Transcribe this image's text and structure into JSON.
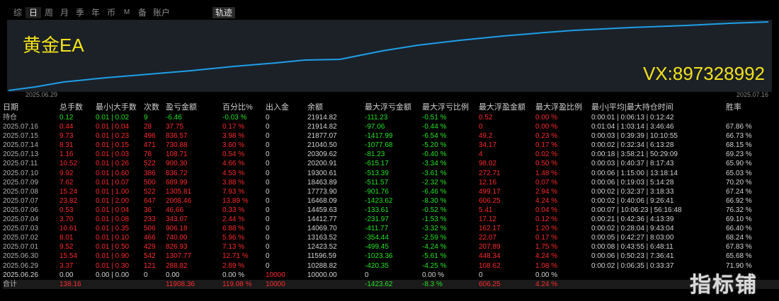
{
  "tabs": [
    {
      "label": "综",
      "active": false
    },
    {
      "label": "日",
      "active": true
    },
    {
      "label": "周",
      "active": false
    },
    {
      "label": "月",
      "active": false
    },
    {
      "label": "季",
      "active": false
    },
    {
      "label": "年",
      "active": false
    },
    {
      "label": "币",
      "active": false
    },
    {
      "label": "M",
      "active": false,
      "small": true
    },
    {
      "label": "备",
      "active": false
    },
    {
      "label": "账户",
      "active": false,
      "wide": true
    }
  ],
  "trail_tab": "轨迹",
  "chart": {
    "title": "黄金EA",
    "contact": "VX:897328992",
    "start_date": "2025.06.29",
    "end_date": "2025.07.16"
  },
  "headers": [
    "日期",
    "总手数",
    "最小|大手数",
    "次数",
    "盈亏金额",
    "百分比%",
    "出入金",
    "余额",
    "最大浮亏金额",
    "最大浮亏比例",
    "最大浮盈金额",
    "最大浮盈比例",
    "最小|平均|最大持仓时间",
    "胜率"
  ],
  "rows": [
    {
      "date": "持仓",
      "lots": "0.12",
      "minmax": "0.01 | 0.02",
      "count": "9",
      "pl": "-6.46",
      "pct": "-0.03 %",
      "io": "0",
      "bal": "21914.82",
      "mfl": "-111.23",
      "mflp": "-0.51 %",
      "mfp": "0.52",
      "mfpp": "0.00 %",
      "time": "0:00:01 | 0:06:13 | 0:12:42",
      "win": "",
      "tone": "green"
    },
    {
      "date": "2025.07.16",
      "lots": "0.44",
      "minmax": "0.01 | 0.04",
      "count": "28",
      "pl": "37.75",
      "pct": "0.17 %",
      "io": "0",
      "bal": "21914.82",
      "mfl": "-97.06",
      "mflp": "-0.44 %",
      "mfp": "0",
      "mfpp": "0.00 %",
      "time": "0:01:04 | 1:03:14 | 3:46:46",
      "win": "67.86 %",
      "tone": "red"
    },
    {
      "date": "2025.07.15",
      "lots": "9.73",
      "minmax": "0.01 | 0.23",
      "count": "496",
      "pl": "836.57",
      "pct": "3.98 %",
      "io": "0",
      "bal": "21877.07",
      "mfl": "-1417.99",
      "mflp": "-6.54 %",
      "mfp": "49.2",
      "mfpp": "0.23 %",
      "time": "0:00:03 | 0:39:39 | 10:10:55",
      "win": "66.73 %",
      "tone": "red"
    },
    {
      "date": "2025.07.14",
      "lots": "8.31",
      "minmax": "0.01 | 0.15",
      "count": "471",
      "pl": "730.88",
      "pct": "3.60 %",
      "io": "0",
      "bal": "21040.50",
      "mfl": "-1077.68",
      "mflp": "-5.20 %",
      "mfp": "34.17",
      "mfpp": "0.17 %",
      "time": "0:00:02 | 0:32:34 | 6:13:28",
      "win": "68.15 %",
      "tone": "red"
    },
    {
      "date": "2025.07.13",
      "lots": "1.16",
      "minmax": "0.01 | 0.03",
      "count": "78",
      "pl": "108.71",
      "pct": "0.54 %",
      "io": "0",
      "bal": "20309.62",
      "mfl": "-81.23",
      "mflp": "-0.40 %",
      "mfp": "4",
      "mfpp": "0.02 %",
      "time": "0:00:18 | 3:58:21 | 50:29:09",
      "win": "69.23 %",
      "tone": "red"
    },
    {
      "date": "2025.07.11",
      "lots": "10.52",
      "minmax": "0.01 | 0.26",
      "count": "522",
      "pl": "900.30",
      "pct": "4.66 %",
      "io": "0",
      "bal": "20200.91",
      "mfl": "-615.17",
      "mflp": "-3.34 %",
      "mfp": "98.02",
      "mfpp": "0.50 %",
      "time": "0:00:03 | 0:40:37 | 8:17:43",
      "win": "65.90 %",
      "tone": "red"
    },
    {
      "date": "2025.07.10",
      "lots": "9.92",
      "minmax": "0.01 | 0.60",
      "count": "386",
      "pl": "836.72",
      "pct": "4.53 %",
      "io": "0",
      "bal": "19300.61",
      "mfl": "-513.39",
      "mflp": "-3.61 %",
      "mfp": "272.71",
      "mfpp": "1.48 %",
      "time": "0:00:06 | 1:15:00 | 13:18:14",
      "win": "65.03 %",
      "tone": "red"
    },
    {
      "date": "2025.07.09",
      "lots": "7.62",
      "minmax": "0.01 | 0.07",
      "count": "500",
      "pl": "689.99",
      "pct": "3.88 %",
      "io": "0",
      "bal": "18463.89",
      "mfl": "-511.57",
      "mflp": "-2.32 %",
      "mfp": "12.16",
      "mfpp": "0.07 %",
      "time": "0:00:06 | 0:19:03 | 5:14:28",
      "win": "70.20 %",
      "tone": "red"
    },
    {
      "date": "2025.07.08",
      "lots": "15.24",
      "minmax": "0.01 | 1.00",
      "count": "522",
      "pl": "1305.81",
      "pct": "7.93 %",
      "io": "0",
      "bal": "17773.90",
      "mfl": "-901.76",
      "mflp": "-6.46 %",
      "mfp": "499.17",
      "mfpp": "2.94 %",
      "time": "0:00:02 | 0:32:37 | 3:18:33",
      "win": "67.24 %",
      "tone": "red"
    },
    {
      "date": "2025.07.07",
      "lots": "23.82",
      "minmax": "0.01 | 2.00",
      "count": "647",
      "pl": "2008.46",
      "pct": "13.89 %",
      "io": "0",
      "bal": "16468.09",
      "mfl": "-1423.62",
      "mflp": "-8.30 %",
      "mfp": "606.25",
      "mfpp": "4.24 %",
      "time": "0:00:02 | 0:40:06 | 9:26:41",
      "win": "66.92 %",
      "tone": "red"
    },
    {
      "date": "2025.07.06",
      "lots": "0.53",
      "minmax": "0.01 | 0.04",
      "count": "36",
      "pl": "46.66",
      "pct": "0.33 %",
      "io": "0",
      "bal": "14459.63",
      "mfl": "-133.61",
      "mflp": "-0.52 %",
      "mfp": "5.41",
      "mfpp": "0.04 %",
      "time": "0:00:07 | 10:06:23 | 56:16:48",
      "win": "76.32 %",
      "tone": "red"
    },
    {
      "date": "2025.07.04",
      "lots": "3.70",
      "minmax": "0.01 | 0.08",
      "count": "233",
      "pl": "343.07",
      "pct": "2.44 %",
      "io": "0",
      "bal": "14412.77",
      "mfl": "-231.97",
      "mflp": "-1.53 %",
      "mfp": "17.12",
      "mfpp": "0.12 %",
      "time": "0:00:21 | 0:42:36 | 4:13:39",
      "win": "69.10 %",
      "tone": "red"
    },
    {
      "date": "2025.07.03",
      "lots": "10.61",
      "minmax": "0.01 | 0.35",
      "count": "506",
      "pl": "906.18",
      "pct": "6.88 %",
      "io": "0",
      "bal": "14069.70",
      "mfl": "-411.77",
      "mflp": "-3.32 %",
      "mfp": "162.17",
      "mfpp": "1.20 %",
      "time": "0:00:02 | 0:28:04 | 9:43:04",
      "win": "66.40 %",
      "tone": "red"
    },
    {
      "date": "2025.07.02",
      "lots": "8.01",
      "minmax": "0.01 | 0.10",
      "count": "466",
      "pl": "740.00",
      "pct": "5.96 %",
      "io": "0",
      "bal": "13163.52",
      "mfl": "-354.44",
      "mflp": "-2.59 %",
      "mfp": "22.07",
      "mfpp": "0.17 %",
      "time": "0:00:05 | 0:42:27 | 8:03:00",
      "win": "68.24 %",
      "tone": "red"
    },
    {
      "date": "2025.07.01",
      "lots": "9.52",
      "minmax": "0.01 | 0.50",
      "count": "429",
      "pl": "826.93",
      "pct": "7.13 %",
      "io": "0",
      "bal": "12423.52",
      "mfl": "-499.45",
      "mflp": "-4.24 %",
      "mfp": "207.89",
      "mfpp": "1.75 %",
      "time": "0:00:08 | 0:43:55 | 6:48:11",
      "win": "67.83 %",
      "tone": "red"
    },
    {
      "date": "2025.06.30",
      "lots": "15.54",
      "minmax": "0.01 | 0.90",
      "count": "542",
      "pl": "1307.77",
      "pct": "12.71 %",
      "io": "0",
      "bal": "11596.59",
      "mfl": "-1023.36",
      "mflp": "-5.61 %",
      "mfp": "448.34",
      "mfpp": "4.24 %",
      "time": "0:00:06 | 0:50:23 | 7:36:41",
      "win": "65.68 %",
      "tone": "red"
    },
    {
      "date": "2025.06.29",
      "lots": "3.37",
      "minmax": "0.01 | 0.30",
      "count": "121",
      "pl": "288.82",
      "pct": "2.89 %",
      "io": "0",
      "bal": "10288.82",
      "mfl": "-420.35",
      "mflp": "-4.25 %",
      "mfp": "108.62",
      "mfpp": "1.08 %",
      "time": "0:00:02 | 0:06:35 | 0:33:37",
      "win": "71.90 %",
      "tone": "red"
    },
    {
      "date": "2025.06.26",
      "lots": "0.00",
      "minmax": "0.00 | 0.00",
      "count": "0",
      "pl": "0.00",
      "pct": "0.00 %",
      "io": "10000",
      "bal": "10000.00",
      "mfl": "0",
      "mflp": "0.00 %",
      "mfp": "0",
      "mfpp": "0.00 %",
      "time": "",
      "win": "",
      "tone": "white"
    }
  ],
  "total": {
    "date": "合计",
    "lots": "138.16",
    "minmax": "",
    "count": "",
    "pl": "11908.36",
    "pct": "119.08 %",
    "io": "10000",
    "bal": "",
    "mfl": "-1423.62",
    "mflp": "-8.3 %",
    "mfp": "606.25",
    "mfpp": "4.24 %",
    "time": "",
    "win": ""
  },
  "watermark": "指标铺"
}
